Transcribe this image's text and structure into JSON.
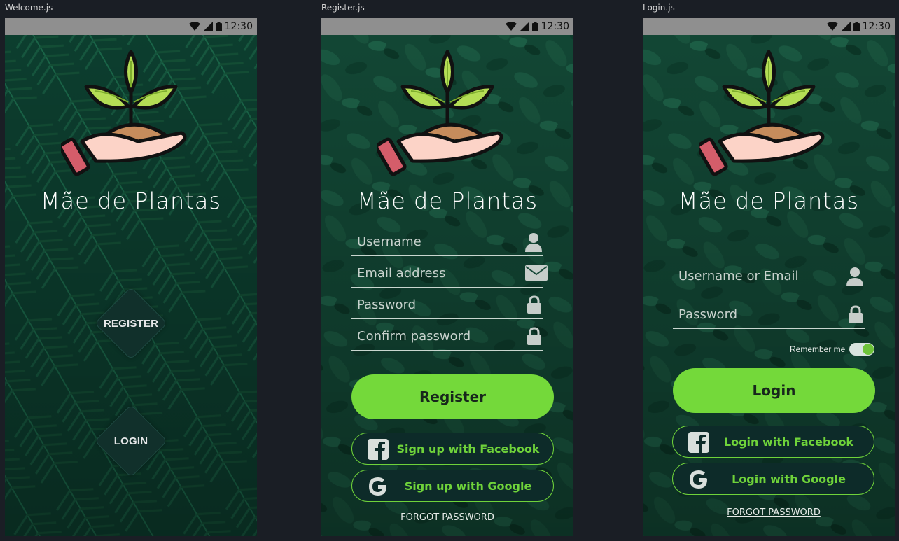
{
  "frames": {
    "welcome_title": "Welcome.js",
    "register_title": "Register.js",
    "login_title": "Login.js"
  },
  "status": {
    "time": "12:30"
  },
  "brand": "Mãe de Plantas",
  "welcome": {
    "register_label": "REGISTER",
    "login_label": "LOGIN"
  },
  "register": {
    "username_placeholder": "Username",
    "email_placeholder": "Email address",
    "password_placeholder": "Password",
    "confirm_placeholder": "Confirm password",
    "submit_label": "Register",
    "facebook_label": "Sign up with Facebook",
    "google_label": "Sign up with Google",
    "forgot_label": "FORGOT PASSWORD"
  },
  "login": {
    "username_placeholder": "Username or Email",
    "password_placeholder": "Password",
    "remember_label": "Remember me",
    "remember_on": true,
    "submit_label": "Login",
    "facebook_label": "Login with Facebook",
    "google_label": "Login with Google",
    "forgot_label": "FORGOT PASSWORD"
  },
  "colors": {
    "accent": "#74d93a",
    "background": "#1a1e25",
    "status_bar": "#8f8f8f",
    "social_bg": "#0d2b29",
    "leaf_bg": "#0f4a37"
  },
  "icons": [
    "wifi-icon",
    "signal-icon",
    "battery-icon",
    "user-icon",
    "envelope-icon",
    "lock-icon",
    "facebook-icon",
    "google-icon"
  ]
}
